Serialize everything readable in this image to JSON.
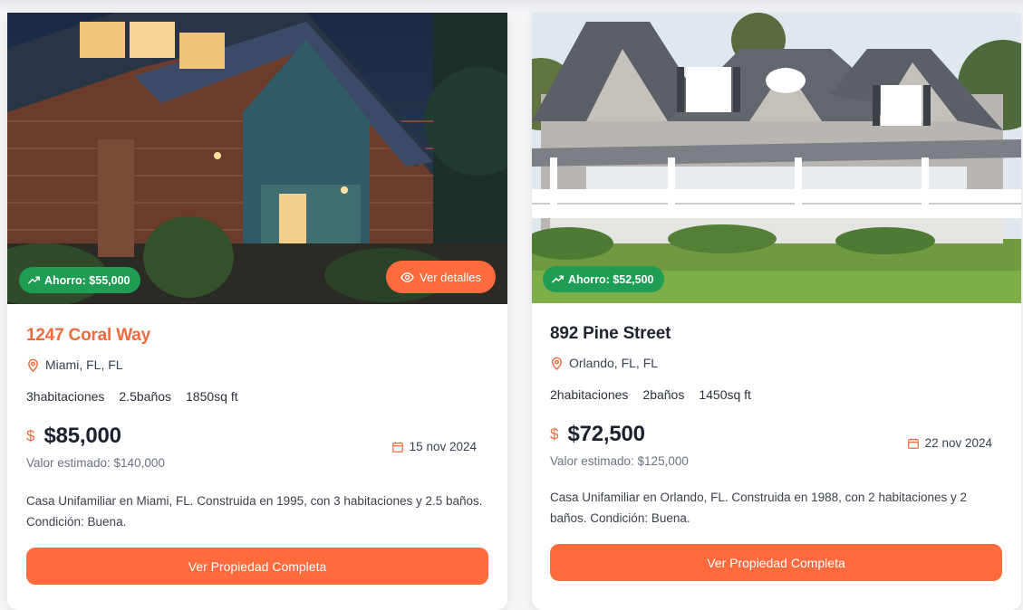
{
  "listings": [
    {
      "savings_badge": "Ahorro: $55,000",
      "details_button": "Ver detalles",
      "address": "1247 Coral Way",
      "location": "Miami, FL, FL",
      "bedrooms": "3habitaciones",
      "bathrooms": "2.5baños",
      "area": "1850sq ft",
      "currency_icon": "$",
      "price": "$85,000",
      "estimated_value": "Valor estimado: $140,000",
      "date": "15 nov 2024",
      "description": "Casa Unifamiliar en Miami, FL. Construida en 1995, con 3 habitaciones y 2.5 baños. Condición: Buena.",
      "cta": "Ver Propiedad Completa"
    },
    {
      "savings_badge": "Ahorro: $52,500",
      "address": "892 Pine Street",
      "location": "Orlando, FL, FL",
      "bedrooms": "2habitaciones",
      "bathrooms": "2baños",
      "area": "1450sq ft",
      "currency_icon": "$",
      "price": "$72,500",
      "estimated_value": "Valor estimado: $125,000",
      "date": "22 nov 2024",
      "description": "Casa Unifamiliar en Orlando, FL. Construida en 1988, con 2 habitaciones y 2 baños. Condición: Buena.",
      "cta": "Ver Propiedad Completa"
    }
  ],
  "colors": {
    "accent": "#ff6b3d",
    "savings_green": "#1f9d55",
    "title_accent": "#f16a3d"
  }
}
